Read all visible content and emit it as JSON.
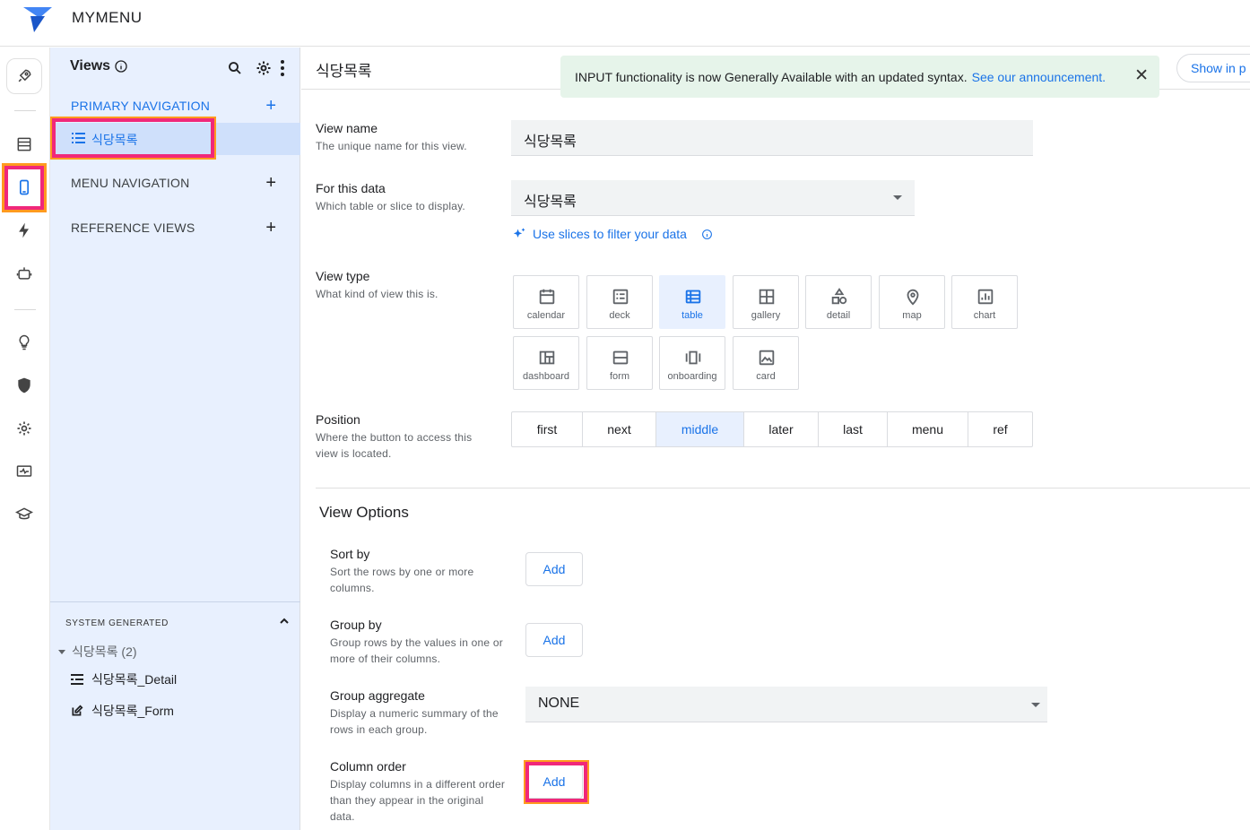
{
  "app": {
    "title": "MYMENU"
  },
  "rail": {
    "items": [
      "rocket-icon",
      "data-table-icon",
      "phone-icon",
      "bolt-icon",
      "bot-icon",
      "lightbulb-icon",
      "shield-icon",
      "gear-icon",
      "monitor-icon",
      "graduation-cap-icon"
    ]
  },
  "views_panel": {
    "title": "Views",
    "primary_navigation_label": "PRIMARY NAVIGATION",
    "primary_items": [
      "식당목록"
    ],
    "menu_navigation_label": "MENU NAVIGATION",
    "reference_views_label": "REFERENCE VIEWS",
    "system_generated_label": "SYSTEM GENERATED",
    "system_group": "식당목록 (2)",
    "system_items": [
      "식당목록_Detail",
      "식당목록_Form"
    ]
  },
  "header": {
    "page_title": "식당목록",
    "toast_text": "INPUT functionality is now Generally Available with an updated syntax.",
    "toast_link": "See our announcement.",
    "show_in_button": "Show in p"
  },
  "form": {
    "view_name_label": "View name",
    "view_name_help": "The unique name for this view.",
    "view_name_value": "식당목록",
    "for_data_label": "For this data",
    "for_data_help": "Which table or slice to display.",
    "for_data_value": "식당목록",
    "slice_link": "Use slices to filter your data",
    "view_type_label": "View type",
    "view_type_help": "What kind of view this is.",
    "view_types": [
      "calendar",
      "deck",
      "table",
      "gallery",
      "detail",
      "map",
      "chart",
      "dashboard",
      "form",
      "onboarding",
      "card"
    ],
    "selected_view_type": "table",
    "position_label": "Position",
    "position_help_1": "Where the button to access this",
    "position_help_2": "view is located.",
    "positions": [
      "first",
      "next",
      "middle",
      "later",
      "last",
      "menu",
      "ref"
    ],
    "selected_position": "middle"
  },
  "view_options": {
    "title": "View Options",
    "sort_by_label": "Sort by",
    "sort_by_help_1": "Sort the rows by one or more",
    "sort_by_help_2": "columns.",
    "group_by_label": "Group by",
    "group_by_help_1": "Group rows by the values in one or",
    "group_by_help_2": "more of their columns.",
    "group_aggregate_label": "Group aggregate",
    "group_aggregate_help_1": "Display a numeric summary of the",
    "group_aggregate_help_2": "rows in each group.",
    "group_aggregate_value": "NONE",
    "column_order_label": "Column order",
    "column_order_help_1": "Display columns in a different order",
    "column_order_help_2": "than they appear in the original",
    "column_order_help_3": "data.",
    "add_label": "Add"
  },
  "colors": {
    "accent": "#1a73e8",
    "highlight_pink": "#f0287a",
    "highlight_orange": "#ff9a1f",
    "toast_bg": "#e6f4ea"
  }
}
